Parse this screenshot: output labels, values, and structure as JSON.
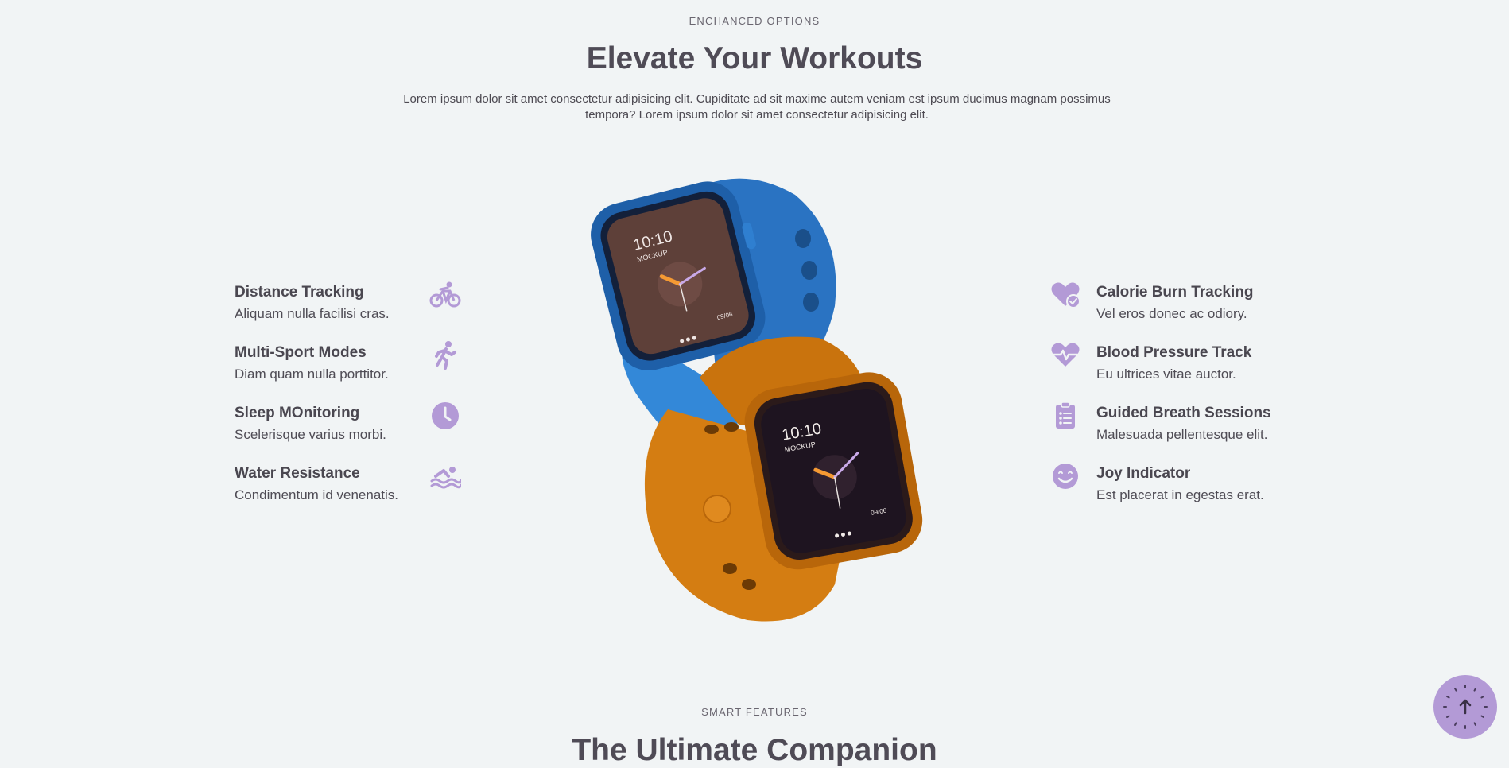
{
  "section": {
    "eyebrow": "ENCHANCED OPTIONS",
    "title": "Elevate Your Workouts",
    "intro": "Lorem ipsum dolor sit amet consectetur adipisicing elit. Cupiditate ad sit maxime autem veniam est ipsum ducimus magnam possimus tempora? Lorem ipsum dolor sit amet consectetur adipisicing elit."
  },
  "features_left": [
    {
      "title": "Distance Tracking",
      "desc": "Aliquam nulla facilisi cras.",
      "icon": "bicycle-icon"
    },
    {
      "title": "Multi-Sport Modes",
      "desc": "Diam quam nulla porttitor.",
      "icon": "runner-icon"
    },
    {
      "title": "Sleep MOnitoring",
      "desc": "Scelerisque varius morbi.",
      "icon": "clock-icon"
    },
    {
      "title": "Water Resistance",
      "desc": "Condimentum id venenatis.",
      "icon": "swimmer-icon"
    }
  ],
  "features_right": [
    {
      "title": "Calorie Burn Tracking",
      "desc": "Vel eros donec ac odiory.",
      "icon": "heart-check-icon"
    },
    {
      "title": "Blood Pressure Track",
      "desc": "Eu ultrices vitae auctor.",
      "icon": "heart-pulse-icon"
    },
    {
      "title": "Guided Breath Sessions",
      "desc": "Malesuada pellentesque elit.",
      "icon": "clipboard-list-icon"
    },
    {
      "title": "Joy Indicator",
      "desc": "Est placerat in egestas erat.",
      "icon": "smile-icon"
    }
  ],
  "watch_screen": {
    "time": "10:10",
    "label": "MOCKUP",
    "date": "09/06"
  },
  "next_section": {
    "eyebrow": "SMART FEATURES",
    "title": "The Ultimate Companion"
  },
  "colors": {
    "accent": "#b39ad6",
    "background": "#f1f4f5",
    "watch_blue": "#2f7fd0",
    "watch_orange": "#d47d12"
  }
}
